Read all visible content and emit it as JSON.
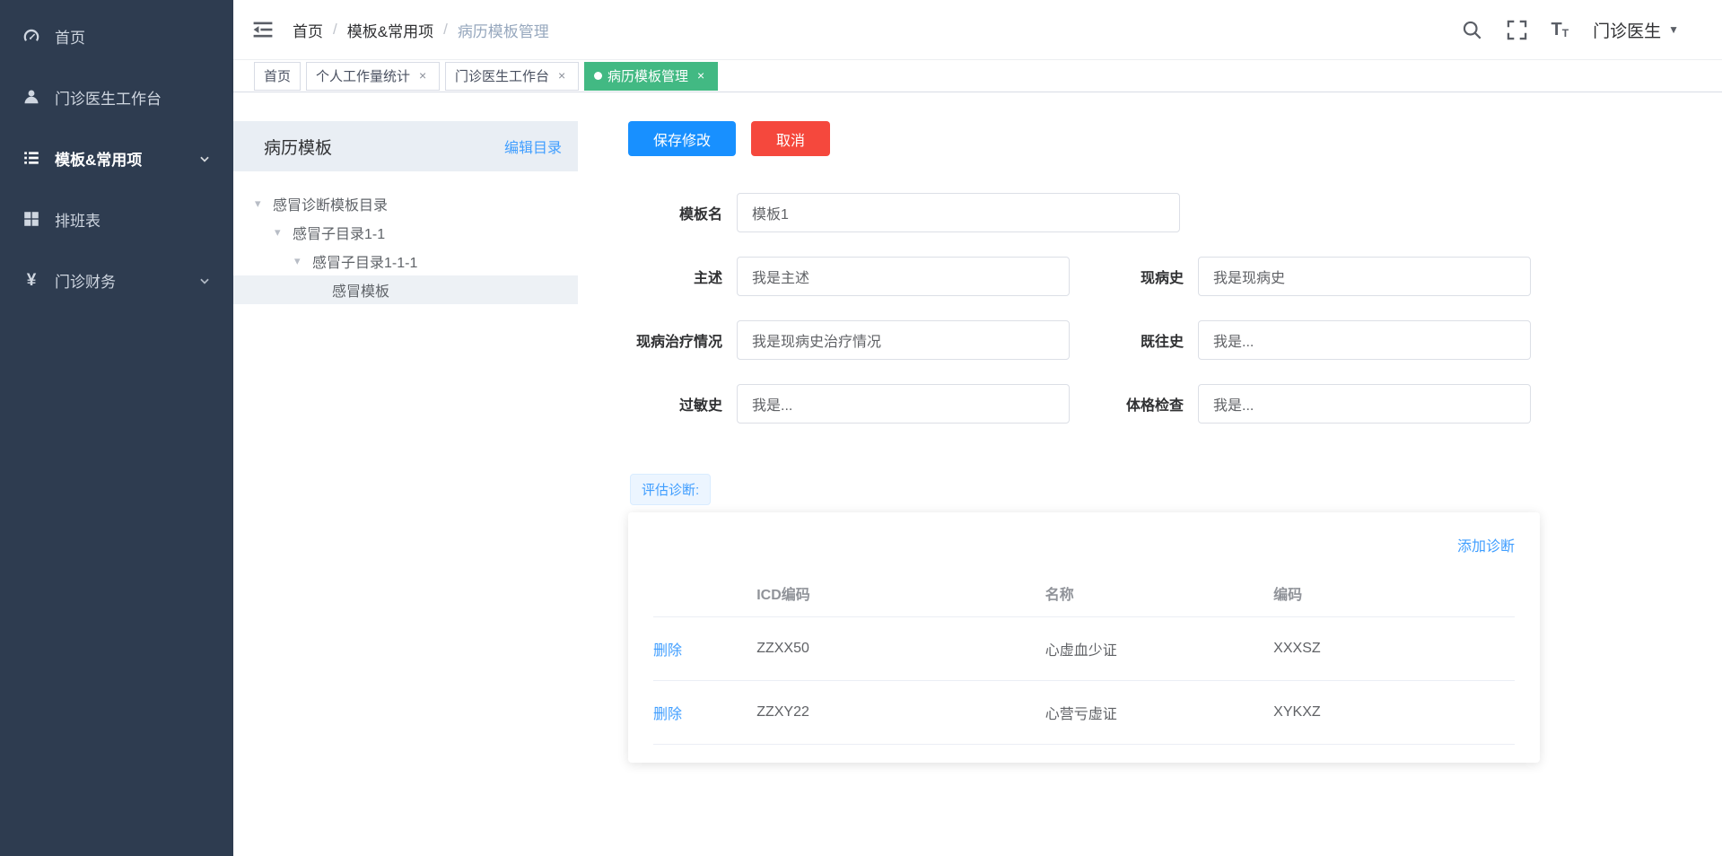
{
  "colors": {
    "sidebar-bg": "#2e3c50",
    "accent-blue": "#1890ff",
    "danger-red": "#f5483d",
    "tab-green": "#42b983",
    "link-blue": "#409eff"
  },
  "ui": {
    "close_glyph": "×",
    "caret_glyph": "▾",
    "dropdown_caret": "▼",
    "yen_glyph": "¥",
    "text_size_glyph": "T"
  },
  "sidebar": {
    "items": [
      {
        "label": "首页",
        "icon": "dashboard-icon",
        "expandable": false,
        "active": false
      },
      {
        "label": "门诊医生工作台",
        "icon": "user-icon",
        "expandable": false,
        "active": false
      },
      {
        "label": "模板&常用项",
        "icon": "template-list-icon",
        "expandable": true,
        "active": true
      },
      {
        "label": "排班表",
        "icon": "schedule-icon",
        "expandable": false,
        "active": false
      },
      {
        "label": "门诊财务",
        "icon": "finance-yen-icon",
        "expandable": true,
        "active": false
      }
    ]
  },
  "navbar": {
    "breadcrumb": {
      "items": [
        "首页",
        "模板&常用项",
        "病历模板管理"
      ],
      "separator": "/"
    },
    "user": {
      "name": "门诊医生"
    }
  },
  "tabs": [
    {
      "label": "首页",
      "closable": false,
      "active": false
    },
    {
      "label": "个人工作量统计",
      "closable": true,
      "active": false
    },
    {
      "label": "门诊医生工作台",
      "closable": true,
      "active": false
    },
    {
      "label": "病历模板管理",
      "closable": true,
      "active": true
    }
  ],
  "tree_panel": {
    "title": "病历模板",
    "edit_link": "编辑目录",
    "nodes": [
      {
        "label": "感冒诊断模板目录",
        "level": 0,
        "expanded": true,
        "selected": false
      },
      {
        "label": "感冒子目录1-1",
        "level": 1,
        "expanded": true,
        "selected": false
      },
      {
        "label": "感冒子目录1-1-1",
        "level": 2,
        "expanded": true,
        "selected": false
      },
      {
        "label": "感冒模板",
        "level": 3,
        "expanded": false,
        "selected": true
      }
    ]
  },
  "form": {
    "save_button": "保存修改",
    "cancel_button": "取消",
    "template_name": {
      "label": "模板名",
      "value": "模板1"
    },
    "chief_complaint": {
      "label": "主述",
      "value": "我是主述"
    },
    "present_illness": {
      "label": "现病史",
      "value": "我是现病史"
    },
    "treatment_status": {
      "label": "现病治疗情况",
      "value": "我是现病史治疗情况"
    },
    "past_history": {
      "label": "既往史",
      "value": "我是..."
    },
    "allergy_history": {
      "label": "过敏史",
      "value": "我是..."
    },
    "physical_exam": {
      "label": "体格检查",
      "value": "我是..."
    },
    "diagnosis_tag": "评估诊断:"
  },
  "diagnosis_card": {
    "add_link": "添加诊断",
    "columns": {
      "action": "",
      "icd": "ICD编码",
      "name": "名称",
      "code": "编码"
    },
    "rows": [
      {
        "action": "删除",
        "icd": "ZZXX50",
        "name": "心虚血少证",
        "code": "XXXSZ"
      },
      {
        "action": "删除",
        "icd": "ZZXY22",
        "name": "心营亏虚证",
        "code": "XYKXZ"
      }
    ]
  }
}
